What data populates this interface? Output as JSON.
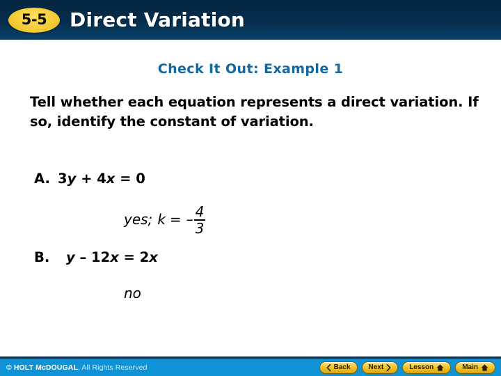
{
  "header": {
    "badge": "5-5",
    "title": "Direct Variation"
  },
  "main": {
    "example_heading": "Check It Out: Example 1",
    "prompt": "Tell whether each equation represents a direct variation. If so, identify the constant of variation.",
    "parts": [
      {
        "letter": "A.",
        "equation": {
          "c1": "3",
          "v1": "y",
          "op": " + ",
          "c2": "4",
          "v2": "x",
          "eq": " = ",
          "rhs": "0"
        },
        "answer": {
          "label": "yes;",
          "k": "k",
          "equals": "=",
          "sign": "–",
          "numerator": "4",
          "denominator": "3"
        }
      },
      {
        "letter": "B.",
        "equation": {
          "v1": "y",
          "op": " – ",
          "c2": "12",
          "v2": "x",
          "eq": " = ",
          "c3": "2",
          "v3": "x"
        },
        "answer": {
          "label": "no"
        }
      }
    ]
  },
  "footer": {
    "copyright_strong": "© HOLT McDOUGAL",
    "copyright_rest": ", All Rights Reserved",
    "buttons": [
      {
        "label": "Back",
        "icon": "chevron-left-icon"
      },
      {
        "label": "Next",
        "icon": "chevron-right-icon"
      },
      {
        "label": "Lesson",
        "icon": "home-icon"
      },
      {
        "label": "Main",
        "icon": "home-icon"
      }
    ]
  },
  "colors": {
    "header_bg": "#04253f",
    "badge_gold": "#f7cf3e",
    "heading_blue": "#12679c",
    "footer_blue": "#1093d6",
    "button_gold": "#f2ca35"
  }
}
